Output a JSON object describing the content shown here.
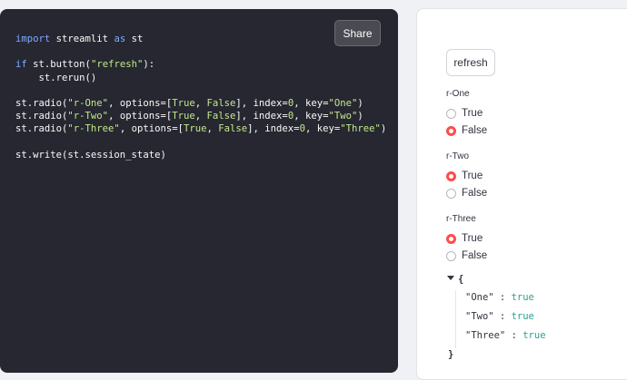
{
  "editor": {
    "lines": [
      [
        {
          "t": "import",
          "c": "kw"
        },
        {
          "t": " streamlit ",
          "c": ""
        },
        {
          "t": "as",
          "c": "kw"
        },
        {
          "t": " st",
          "c": ""
        }
      ],
      [],
      [
        {
          "t": "if",
          "c": "kw"
        },
        {
          "t": " st.button(",
          "c": ""
        },
        {
          "t": "\"refresh\"",
          "c": "str"
        },
        {
          "t": "):",
          "c": ""
        }
      ],
      [
        {
          "t": "    st.rerun()",
          "c": ""
        }
      ],
      [],
      [
        {
          "t": "st.radio(",
          "c": ""
        },
        {
          "t": "\"r-One\"",
          "c": "str"
        },
        {
          "t": ", options=[",
          "c": ""
        },
        {
          "t": "True",
          "c": "str"
        },
        {
          "t": ", ",
          "c": ""
        },
        {
          "t": "False",
          "c": "str"
        },
        {
          "t": "], index=",
          "c": ""
        },
        {
          "t": "0",
          "c": "str"
        },
        {
          "t": ", key=",
          "c": ""
        },
        {
          "t": "\"One\"",
          "c": "str"
        },
        {
          "t": ")",
          "c": ""
        }
      ],
      [
        {
          "t": "st.radio(",
          "c": ""
        },
        {
          "t": "\"r-Two\"",
          "c": "str"
        },
        {
          "t": ", options=[",
          "c": ""
        },
        {
          "t": "True",
          "c": "str"
        },
        {
          "t": ", ",
          "c": ""
        },
        {
          "t": "False",
          "c": "str"
        },
        {
          "t": "], index=",
          "c": ""
        },
        {
          "t": "0",
          "c": "str"
        },
        {
          "t": ", key=",
          "c": ""
        },
        {
          "t": "\"Two\"",
          "c": "str"
        },
        {
          "t": ")",
          "c": ""
        }
      ],
      [
        {
          "t": "st.radio(",
          "c": ""
        },
        {
          "t": "\"r-Three\"",
          "c": "str"
        },
        {
          "t": ", options=[",
          "c": ""
        },
        {
          "t": "True",
          "c": "str"
        },
        {
          "t": ", ",
          "c": ""
        },
        {
          "t": "False",
          "c": "str"
        },
        {
          "t": "], index=",
          "c": ""
        },
        {
          "t": "0",
          "c": "str"
        },
        {
          "t": ", key=",
          "c": ""
        },
        {
          "t": "\"Three\"",
          "c": "str"
        },
        {
          "t": ")",
          "c": ""
        }
      ],
      [],
      [
        {
          "t": "st.write(st.session_state)",
          "c": ""
        }
      ]
    ],
    "share_label": "Share"
  },
  "app": {
    "refresh_label": "refresh",
    "radios": [
      {
        "label": "r-One",
        "options": [
          "True",
          "False"
        ],
        "selected": 1
      },
      {
        "label": "r-Two",
        "options": [
          "True",
          "False"
        ],
        "selected": 0
      },
      {
        "label": "r-Three",
        "options": [
          "True",
          "False"
        ],
        "selected": 0
      }
    ],
    "state": {
      "open": "{",
      "close": "}",
      "entries": [
        {
          "key": "\"One\"",
          "value": "true"
        },
        {
          "key": "\"Two\"",
          "value": "true"
        },
        {
          "key": "\"Three\"",
          "value": "true"
        }
      ]
    }
  },
  "colors": {
    "accent": "#ff4b4b",
    "editor_bg": "#262730",
    "json_value": "#2e9d8f"
  }
}
